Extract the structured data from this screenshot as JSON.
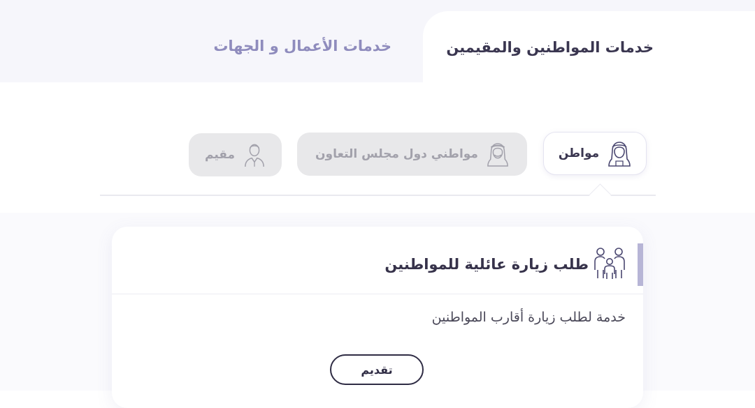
{
  "tabs": {
    "active_label": "خدمات المواطنين والمقيمين",
    "inactive_label": "خدمات الأعمال و الجهات"
  },
  "user_types": [
    {
      "label": "مواطن",
      "icon": "citizen-icon",
      "selected": true
    },
    {
      "label": "مواطني دول مجلس التعاون",
      "icon": "gcc-citizen-icon",
      "selected": false
    },
    {
      "label": "مقيم",
      "icon": "resident-icon",
      "selected": false
    }
  ],
  "service_card": {
    "icon": "family-icon",
    "title": "طلب زيارة عائلية للمواطنين",
    "description": "خدمة لطلب زيارة أقارب المواطنين",
    "apply_label": "تقديم"
  },
  "colors": {
    "active_text": "#3a3650",
    "inactive_tab_text": "#8f8cbd",
    "disabled_pill_bg": "#e8e8ea",
    "accent_bar": "#b7b5d6"
  }
}
